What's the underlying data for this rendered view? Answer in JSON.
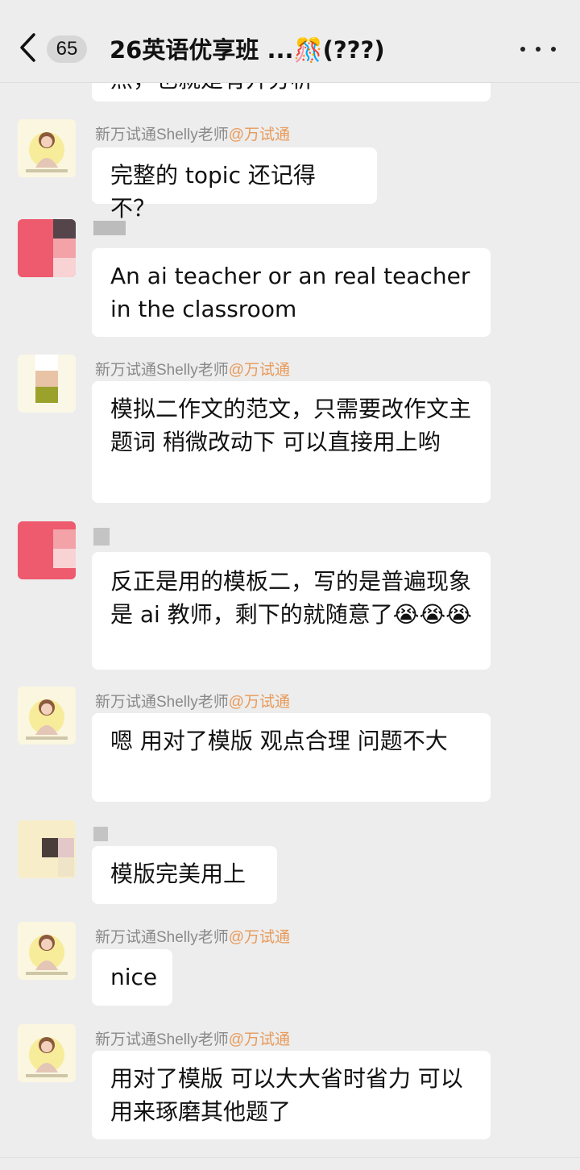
{
  "header": {
    "back_badge": "65",
    "title": "26英语优享班 ...🎊(???)"
  },
  "top_partial": {
    "text": "点，也就是有开分析"
  },
  "messages": [
    {
      "sender": "新万试通Shelly老师",
      "mention": "@万试通",
      "text": "完整的 topic 还记得不？"
    },
    {
      "sender": "",
      "mention": "",
      "text": "An ai teacher or an real teacher in the classroom"
    },
    {
      "sender": "新万试通Shelly老师",
      "mention": "@万试通",
      "text": "模拟二作文的范文，只需要改作文主题词 稍微改动下 可以直接用上哟"
    },
    {
      "sender": "",
      "mention": "",
      "text": "反正是用的模板二，写的是普遍现象是 ai 教师，剩下的就随意了😭😭😭"
    },
    {
      "sender": "新万试通Shelly老师",
      "mention": "@万试通",
      "text": "嗯 用对了模版  观点合理  问题不大"
    },
    {
      "sender": "",
      "mention": "",
      "text": "模版完美用上"
    },
    {
      "sender": "新万试通Shelly老师",
      "mention": "@万试通",
      "text": "nice"
    },
    {
      "sender": "新万试通Shelly老师",
      "mention": "@万试通",
      "text": "用对了模版 可以大大省时省力 可以用来琢磨其他题了"
    }
  ],
  "colors": {
    "background": "#ededed",
    "bubble": "#ffffff",
    "mention": "#e89a5a",
    "sender": "#8a8a8a"
  },
  "icons": {
    "back": "chevron-left-icon",
    "more": "more-dots-icon",
    "avatar": "teacher-avatar-icon"
  }
}
